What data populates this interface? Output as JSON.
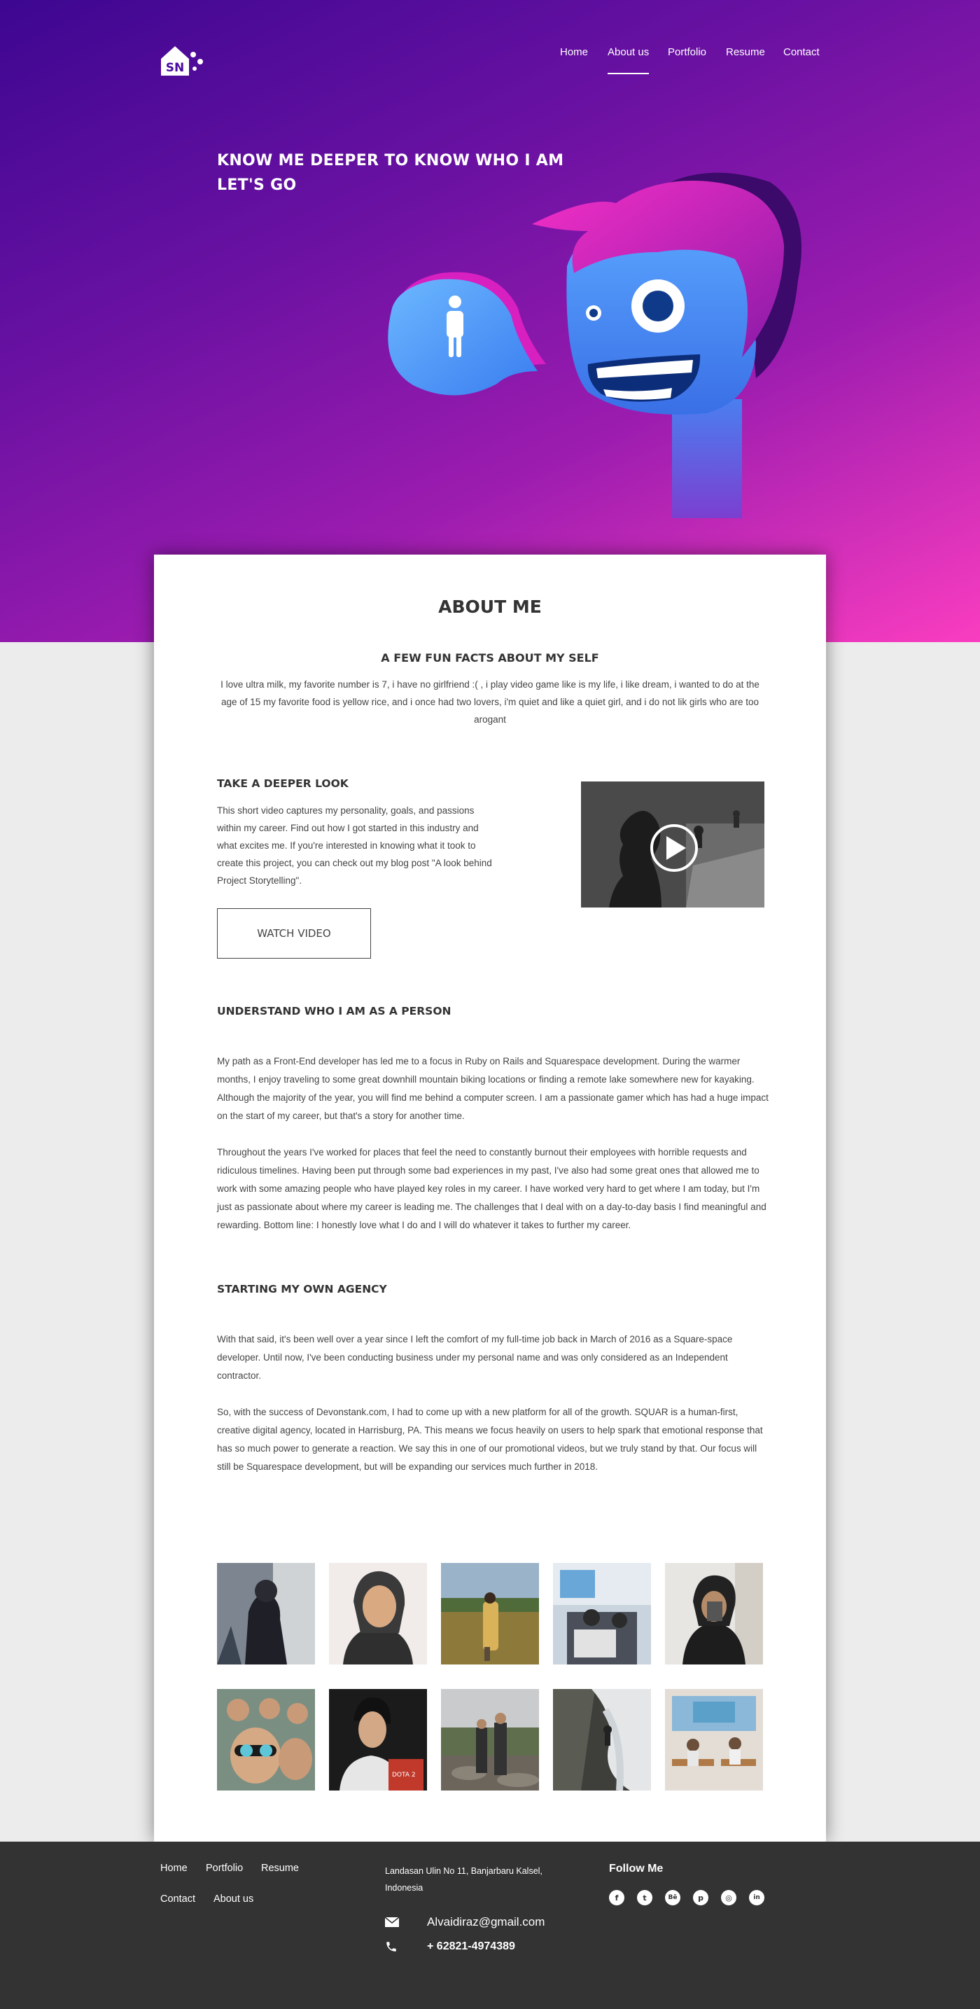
{
  "brand": {
    "logo_text": "SN"
  },
  "nav": {
    "items": [
      "Home",
      "About us",
      "Portfolio",
      "Resume",
      "Contact"
    ],
    "active": "About us"
  },
  "hero": {
    "tagline_line1": "KNOW ME DEEPER TO KNOW WHO I AM",
    "tagline_line2": "LET'S GO"
  },
  "about": {
    "title": "ABOUT ME",
    "facts_title": "A FEW FUN FACTS ABOUT MY SELF",
    "facts_text": "I love ultra milk, my favorite number is 7, i have no girlfriend :( , i play video game like is my life, i like dream, i wanted to do at the age of 15 my favorite food is yellow rice, and i once had two lovers, i'm quiet and like a quiet girl, and i do not lik girls who are too arogant",
    "deeper_title": "TAKE A DEEPER LOOK",
    "deeper_text": "This short video captures my personality, goals, and passions within my career. Find out how I got started in this industry and what excites me. If you're interested in knowing what it took to create this project, you can check out my blog post \"A look behind Project Storytelling\".",
    "watch_label": "WATCH VIDEO",
    "person_title": "UNDERSTAND WHO I AM AS A PERSON",
    "person_p1": "My path as a Front-End developer has led me to a focus in Ruby on Rails and Squarespace development. During the warmer months, I enjoy traveling to some great downhill mountain biking locations or finding a remote lake somewhere new for kayaking. Although the majority of the year, you will find me behind a computer screen. I am a passionate gamer which has had a huge impact on the start of my career, but that's a story for another time.",
    "person_p2": "Throughout the years I've worked for places that feel the need to constantly burnout their employees with horrible requests and ridiculous timelines. Having been put through some bad experiences in my past, I've also had some great ones that allowed me to work with some amazing people who have played key roles in my career. I have worked very hard to get where I am today, but I'm just as passionate about where my career is leading me. The challenges that I deal with on a day-to-day basis I find meaningful and rewarding. Bottom line: I honestly love what I do and I will do whatever it takes to further my career.",
    "agency_title": "STARTING MY OWN AGENCY",
    "agency_p1": "With that said, it's been well over a year since I left the comfort of my full-time job back in March of 2016 as a Square-space developer. Until now, I've been conducting business under my personal name and was only considered as an Independent contractor.",
    "agency_p2": "So, with the success of Devonstank.com, I had to come up with a new platform for all of the growth. SQUAR is a human-first, creative digital agency, located in Harrisburg, PA. This means we focus heavily on users to help spark that emotional response that has so much power to generate a reaction. We say this in one of our promotional videos, but we truly stand by that. Our focus will still be Squarespace development, but will be expanding our services much further in 2018."
  },
  "footer": {
    "links": [
      "Home",
      "Portfolio",
      "Resume",
      "Contact",
      "About us"
    ],
    "address": "Landasan Ulin No 11, Banjarbaru Kalsel, Indonesia",
    "email": "Alvaidiraz@gmail.com",
    "phone": "+ 62821-4974389",
    "follow_title": "Follow Me",
    "social_icons": [
      "facebook-icon",
      "twitter-icon",
      "behance-icon",
      "pinterest-icon",
      "instagram-icon",
      "linkedin-icon"
    ],
    "social_glyphs": [
      "f",
      "t",
      "Bē",
      "p",
      "◎",
      "in"
    ]
  },
  "colors": {
    "hero_start": "#3d0791",
    "hero_end": "#fa3dc0",
    "footer_bg": "#333333",
    "card_bg": "#ffffff"
  }
}
